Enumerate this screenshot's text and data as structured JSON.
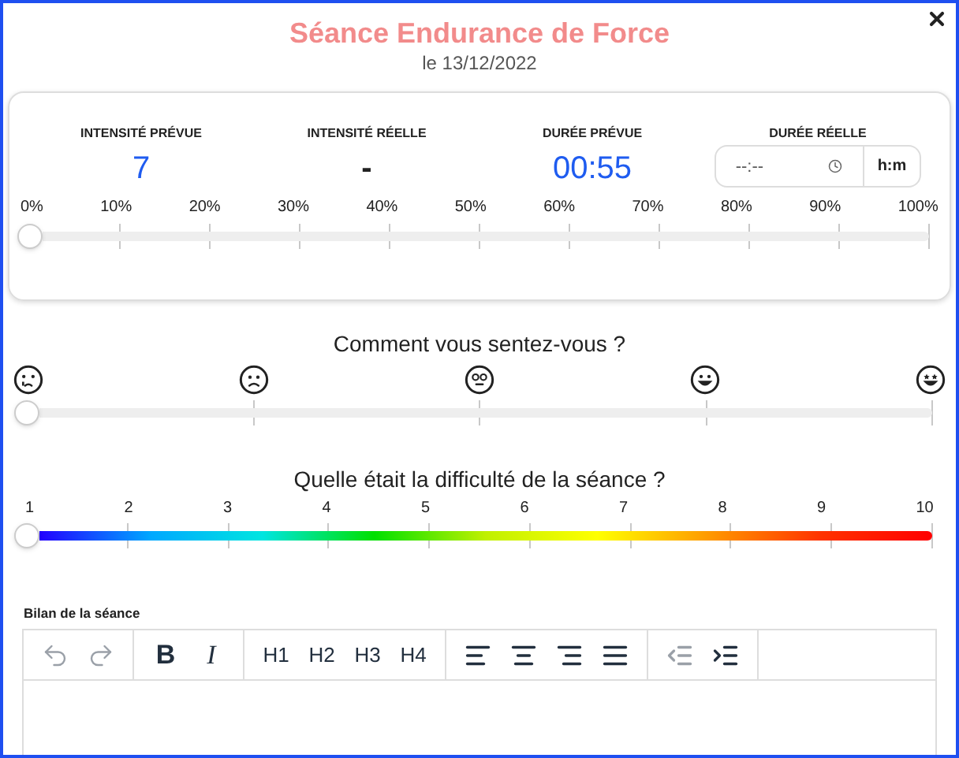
{
  "title": "Séance Endurance de Force",
  "date": "le 13/12/2022",
  "stats": [
    {
      "kind": "value",
      "label": "INTENSITÉ PRÉVUE",
      "value": "7",
      "highlighted": true
    },
    {
      "kind": "value",
      "label": "INTENSITÉ RÉELLE",
      "value": "-",
      "highlighted": false
    },
    {
      "kind": "value",
      "label": "DURÉE PRÉVUE",
      "value": "00:55",
      "highlighted": true
    },
    {
      "kind": "input",
      "label": "DURÉE RÉELLE",
      "placeholder": "--:--",
      "unit": "h:m"
    }
  ],
  "intensity": {
    "ticks": [
      "0%",
      "10%",
      "20%",
      "30%",
      "40%",
      "50%",
      "60%",
      "70%",
      "80%",
      "90%",
      "100%"
    ],
    "level": 0
  },
  "feeling": {
    "question": "Comment vous sentez-vous ?",
    "level": 0
  },
  "difficulty": {
    "question": "Quelle était la difficulté de la séance ?",
    "ticks": [
      "1",
      "2",
      "3",
      "4",
      "5",
      "6",
      "7",
      "8",
      "9",
      "10"
    ],
    "level": 0
  },
  "editor": {
    "label": "Bilan de la séance",
    "toolbar": [
      [
        {
          "kind": "undo",
          "disabled": true
        },
        {
          "kind": "redo",
          "disabled": true
        }
      ],
      [
        {
          "kind": "bold",
          "label": "B",
          "disabled": false
        },
        {
          "kind": "italic",
          "label": "I",
          "disabled": false
        }
      ],
      [
        {
          "kind": "heading",
          "label": "H1",
          "disabled": false
        },
        {
          "kind": "heading",
          "label": "H2",
          "disabled": false
        },
        {
          "kind": "heading",
          "label": "H3",
          "disabled": false
        },
        {
          "kind": "heading",
          "label": "H4",
          "disabled": false
        }
      ],
      [
        {
          "kind": "align-left",
          "disabled": false
        },
        {
          "kind": "align-center",
          "disabled": false
        },
        {
          "kind": "align-right",
          "disabled": false
        },
        {
          "kind": "align-justify",
          "disabled": false
        }
      ],
      [
        {
          "kind": "outdent",
          "disabled": true
        },
        {
          "kind": "indent",
          "disabled": false
        }
      ]
    ]
  }
}
